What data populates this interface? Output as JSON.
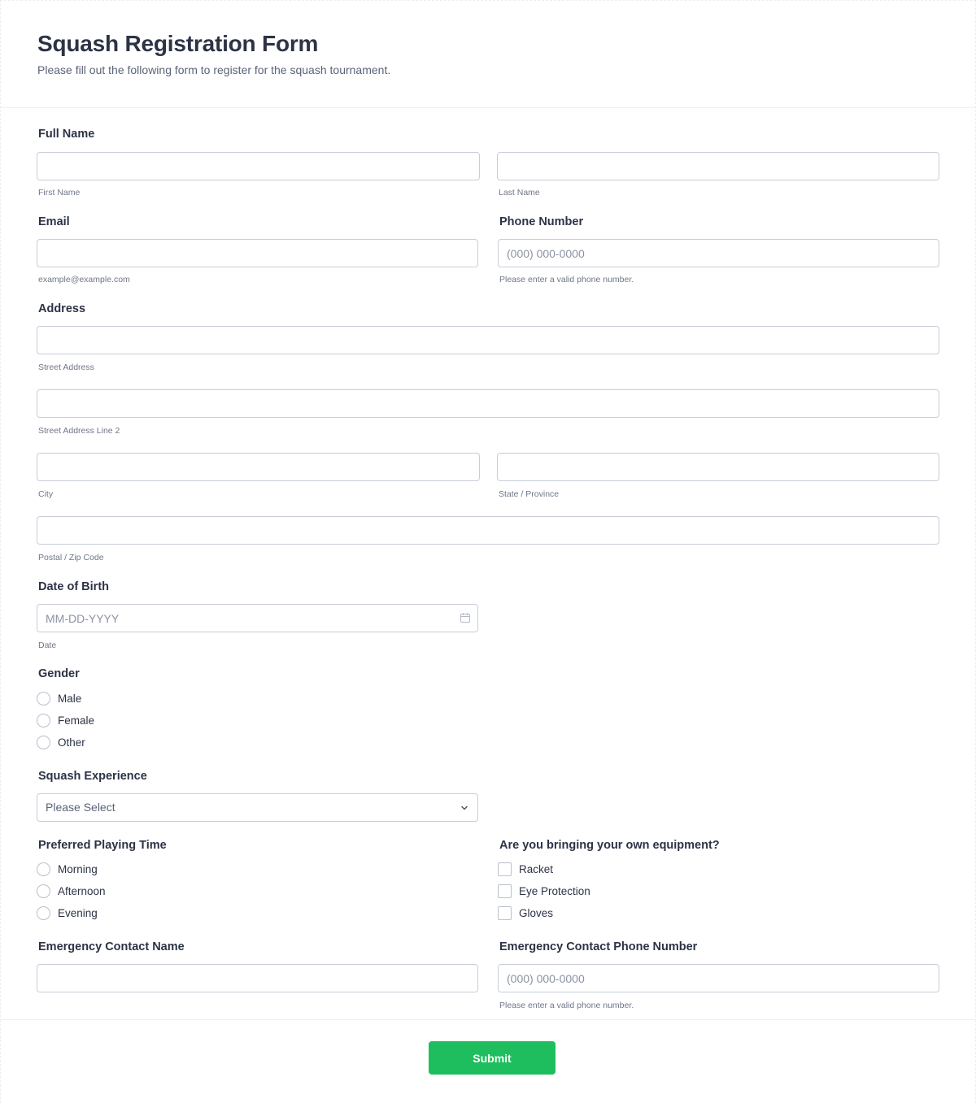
{
  "header": {
    "title": "Squash Registration Form",
    "subtitle": "Please fill out the following form to register for the squash tournament."
  },
  "full_name": {
    "label": "Full Name",
    "first_value": "",
    "first_sublabel": "First Name",
    "last_value": "",
    "last_sublabel": "Last Name"
  },
  "email": {
    "label": "Email",
    "value": "",
    "sublabel": "example@example.com"
  },
  "phone": {
    "label": "Phone Number",
    "placeholder": "(000) 000-0000",
    "sublabel": "Please enter a valid phone number."
  },
  "address": {
    "label": "Address",
    "street_sublabel": "Street Address",
    "street2_sublabel": "Street Address Line 2",
    "city_sublabel": "City",
    "state_sublabel": "State / Province",
    "zip_sublabel": "Postal / Zip Code"
  },
  "dob": {
    "label": "Date of Birth",
    "placeholder": "MM-DD-YYYY",
    "sublabel": "Date",
    "icon": "calendar-icon"
  },
  "gender": {
    "label": "Gender",
    "options": [
      "Male",
      "Female",
      "Other"
    ]
  },
  "experience": {
    "label": "Squash Experience",
    "selected": "Please Select",
    "icon": "chevron-down-icon"
  },
  "playing_time": {
    "label": "Preferred Playing Time",
    "options": [
      "Morning",
      "Afternoon",
      "Evening"
    ]
  },
  "equipment": {
    "label": "Are you bringing your own equipment?",
    "options": [
      "Racket",
      "Eye Protection",
      "Gloves"
    ]
  },
  "emergency_name": {
    "label": "Emergency Contact Name",
    "value": ""
  },
  "emergency_phone": {
    "label": "Emergency Contact Phone Number",
    "placeholder": "(000) 000-0000",
    "sublabel": "Please enter a valid phone number."
  },
  "submit": {
    "label": "Submit",
    "color": "#1ebe5e"
  }
}
